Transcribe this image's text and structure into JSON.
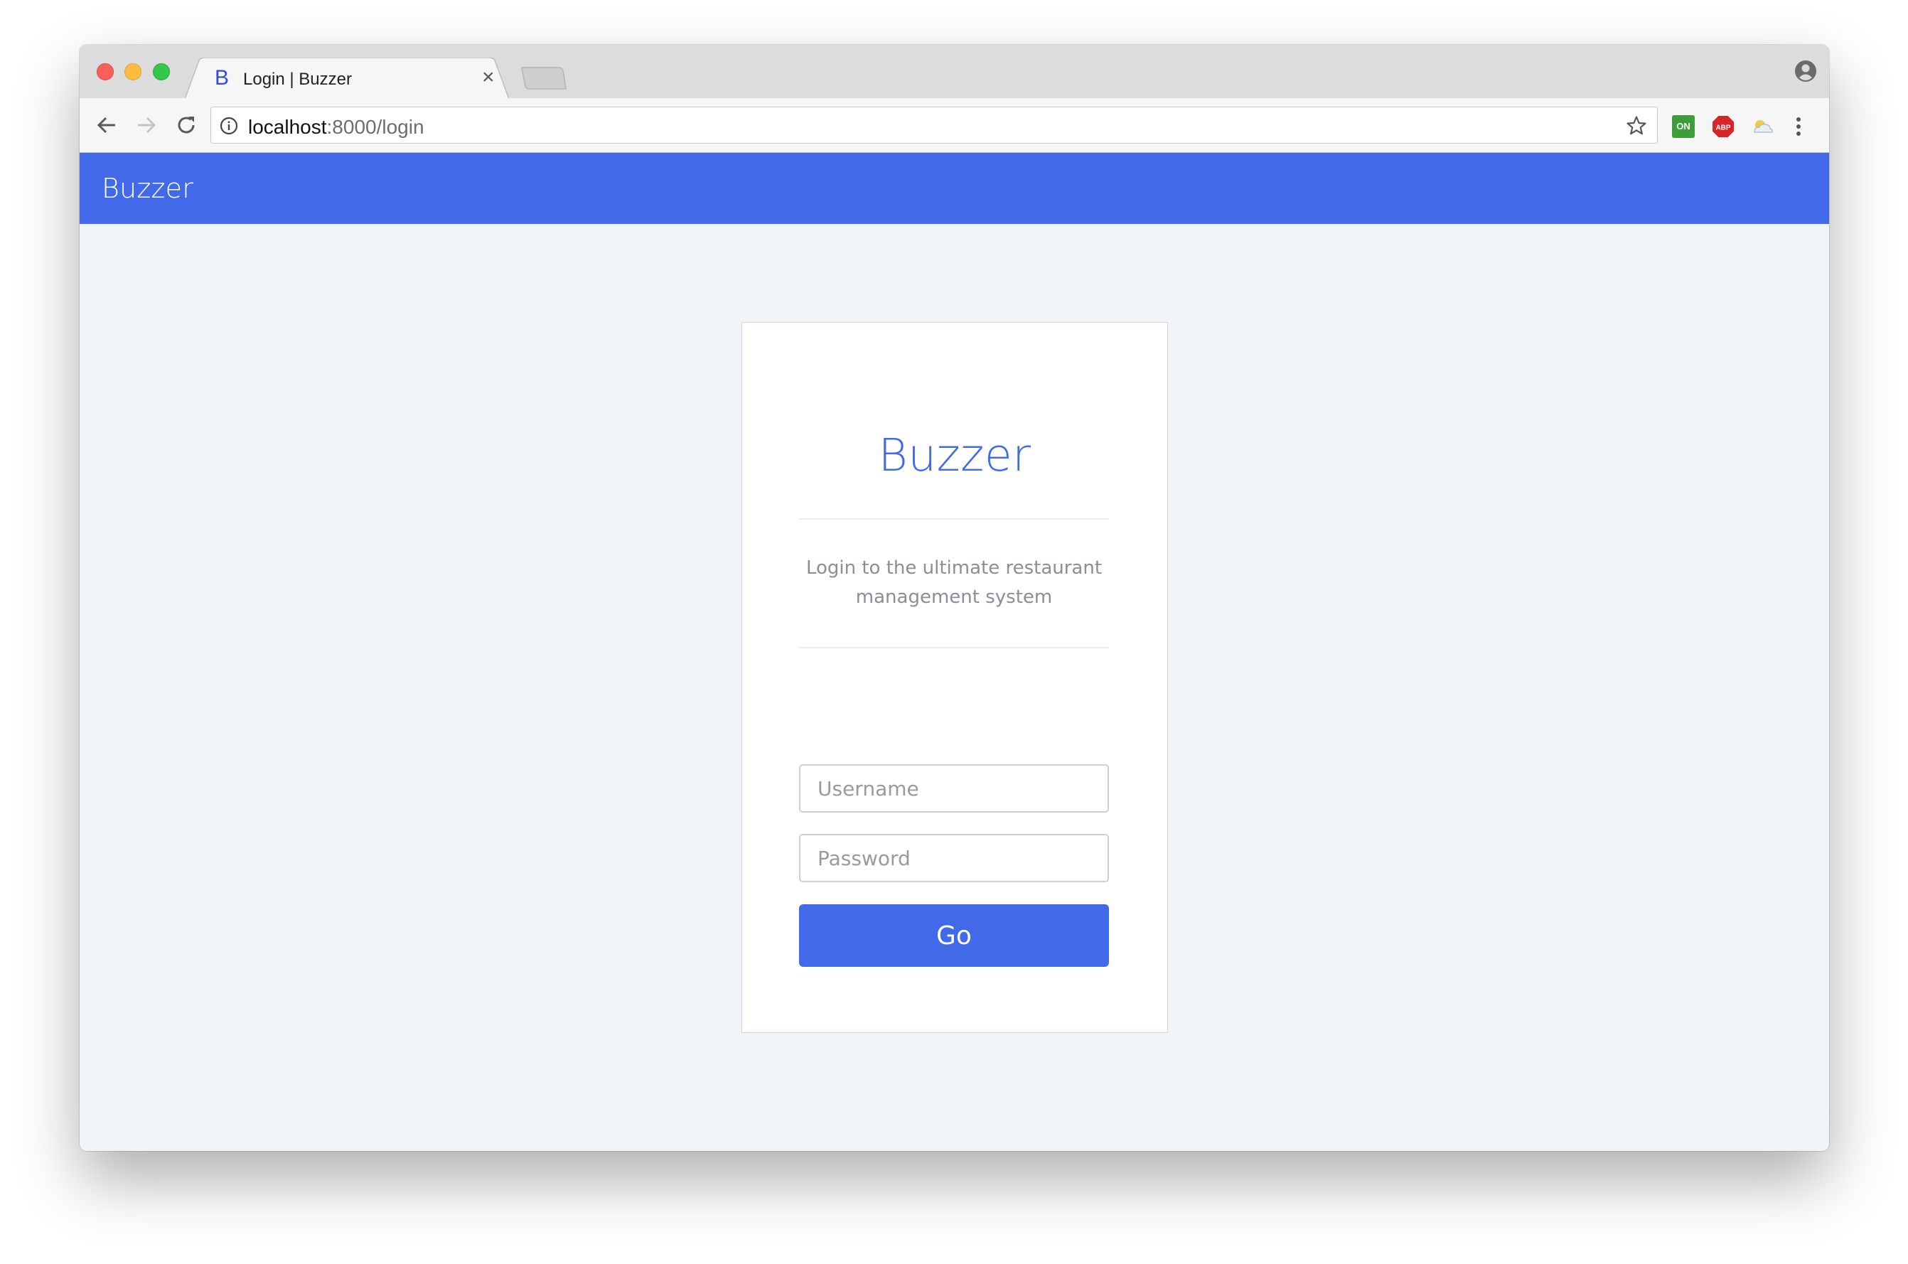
{
  "browser": {
    "tab": {
      "favicon_letter": "B",
      "title": "Login | Buzzer",
      "close_glyph": "×"
    },
    "address": {
      "host": "localhost",
      "rest": ":8000/login"
    },
    "extensions": [
      {
        "name": "on-extension-icon",
        "label": "ON",
        "color": "#3b9e3b"
      },
      {
        "name": "adblock-plus-icon",
        "label": "ABP",
        "color": "#d7262a"
      },
      {
        "name": "weather-extension-icon",
        "label": "",
        "color": "#a8b8c8"
      }
    ],
    "icons": [
      "back-arrow-icon",
      "forward-arrow-icon",
      "reload-icon",
      "info-icon",
      "star-icon",
      "menu-dots-icon",
      "profile-icon",
      "new-tab-icon"
    ]
  },
  "app": {
    "navbar_brand": "Buzzer",
    "accent_color": "#4169e8",
    "page_bg_color": "#f0f3f7"
  },
  "login": {
    "title": "Buzzer",
    "subtitle": "Login to the ultimate restaurant management system",
    "username_placeholder": "Username",
    "password_placeholder": "Password",
    "submit_label": "Go"
  }
}
